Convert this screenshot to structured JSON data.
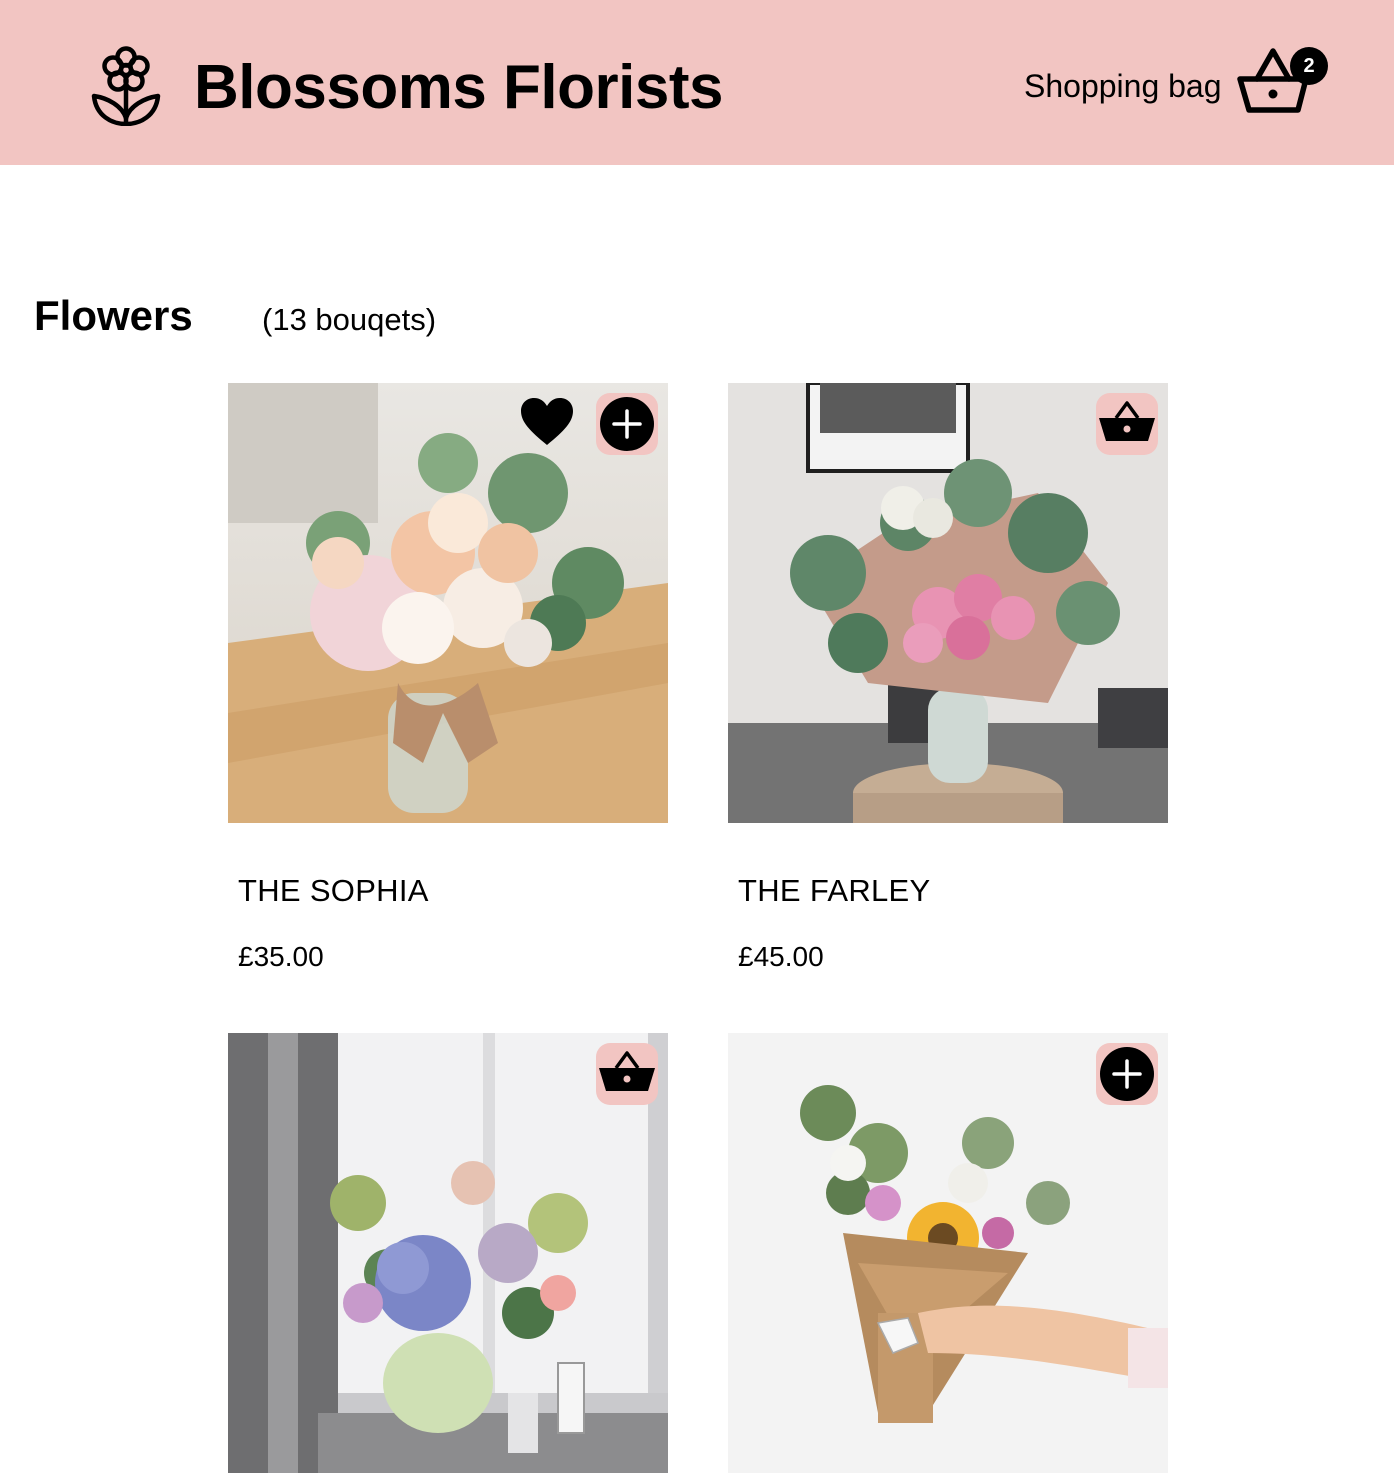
{
  "header": {
    "brand": "Blossoms Florists",
    "bag_label": "Shopping bag",
    "bag_count": "2",
    "logo_icon": "flower-icon",
    "bag_icon": "basket-icon"
  },
  "section": {
    "title": "Flowers",
    "count": "(13 bouqets)"
  },
  "products": [
    {
      "name": "THE SOPHIA",
      "price": "£35.00",
      "action_icon": "plus-circle-icon",
      "favorited": true
    },
    {
      "name": "THE FARLEY",
      "price": "£45.00",
      "action_icon": "basket-icon",
      "favorited": false
    },
    {
      "name": "",
      "price": "",
      "action_icon": "basket-icon",
      "favorited": false
    },
    {
      "name": "",
      "price": "",
      "action_icon": "plus-circle-icon",
      "favorited": false
    }
  ],
  "colors": {
    "header_bg": "#f2c5c2",
    "action_bg": "#f2c5c2",
    "text": "#000000"
  }
}
